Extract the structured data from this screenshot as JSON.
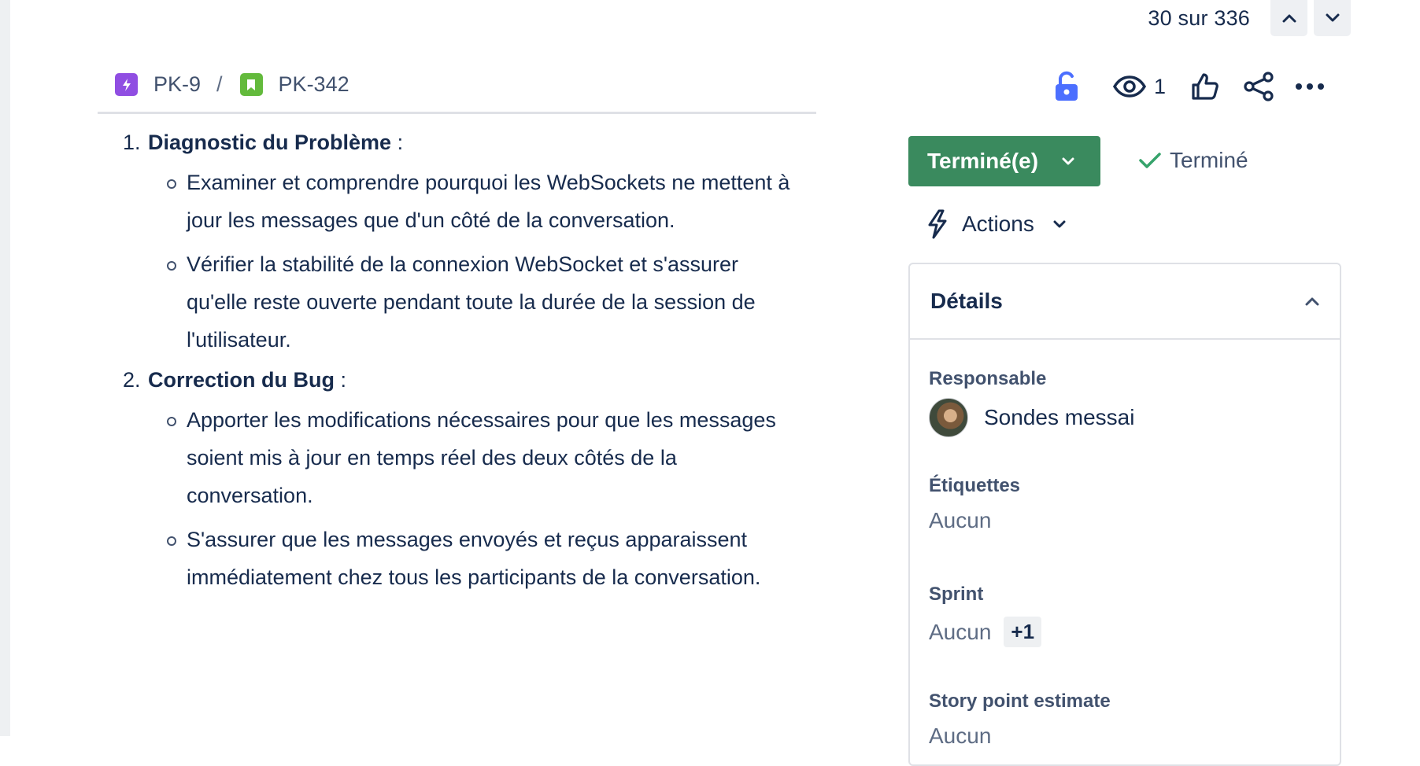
{
  "pager": {
    "text": "30 sur 336"
  },
  "breadcrumb": {
    "parent_key": "PK-9",
    "separator": "/",
    "issue_key": "PK-342"
  },
  "header": {
    "watch_count": "1"
  },
  "description": {
    "items": [
      {
        "number": "1.",
        "title": "Diagnostic du Problème",
        "suffix": " :",
        "bullets": [
          "Examiner et comprendre pourquoi les WebSockets ne mettent à jour les messages que d'un côté de la conversation.",
          "Vérifier la stabilité de la connexion WebSocket et s'assurer qu'elle reste ouverte pendant toute la durée de la session de l'utilisateur."
        ]
      },
      {
        "number": "2.",
        "title": "Correction du Bug",
        "suffix": " :",
        "bullets": [
          "Apporter les modifications nécessaires pour que les messages soient mis à jour en temps réel des deux côtés de la conversation.",
          "S'assurer que les messages envoyés et reçus apparaissent immédiatement chez tous les participants de la conversation."
        ]
      }
    ]
  },
  "status": {
    "label": "Terminé(e)",
    "resolution": "Terminé",
    "color": "#3a8a5e"
  },
  "actions": {
    "label": "Actions"
  },
  "details": {
    "title": "Détails",
    "assignee_label": "Responsable",
    "assignee_name": "Sondes messai",
    "labels_label": "Étiquettes",
    "labels_value": "Aucun",
    "sprint_label": "Sprint",
    "sprint_value": "Aucun",
    "sprint_extra": "+1",
    "story_points_label": "Story point estimate",
    "story_points_value": "Aucun"
  }
}
